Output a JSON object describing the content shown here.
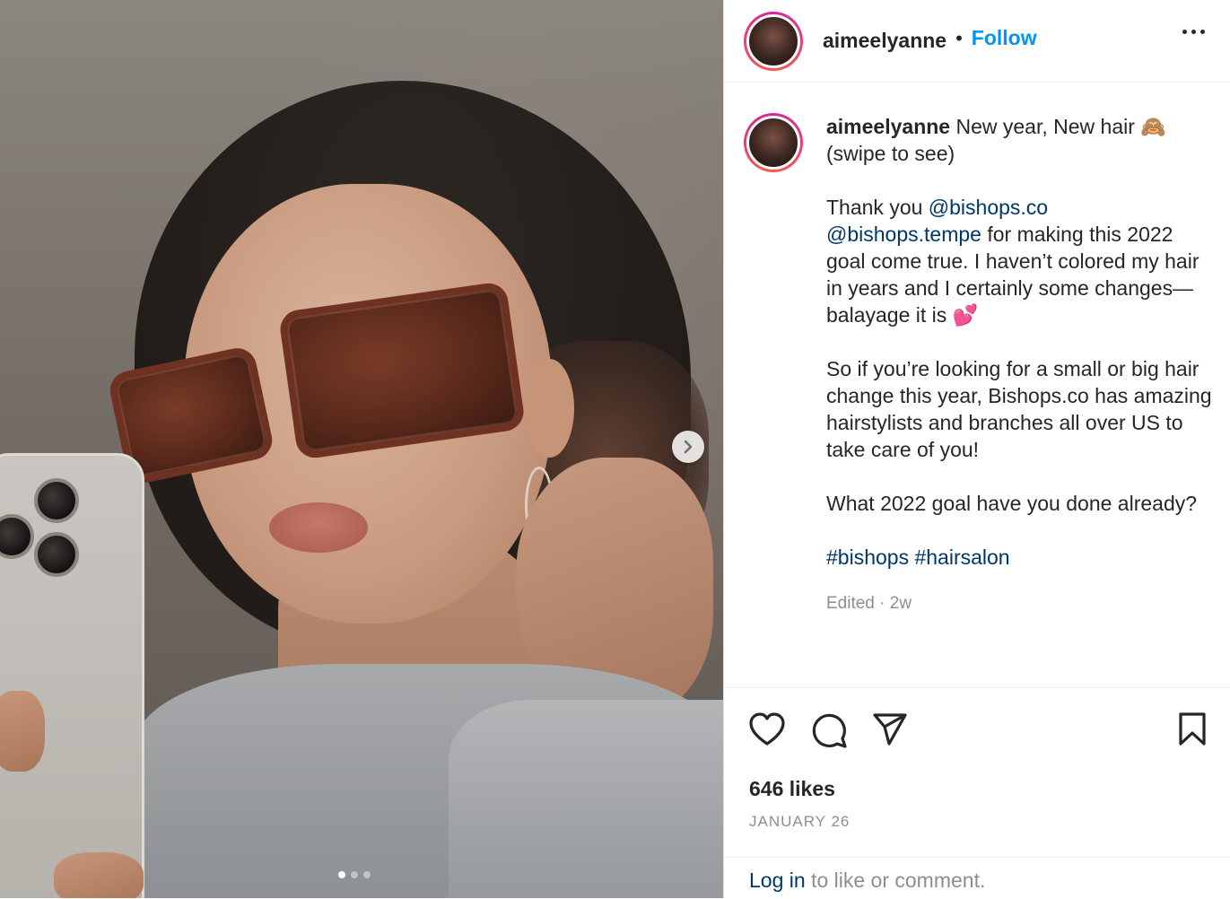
{
  "post": {
    "username": "aimeelyanne",
    "separator": "•",
    "follow_label": "Follow",
    "more_icon": "more-horizontal-icon"
  },
  "caption": {
    "username": "aimeelyanne",
    "line1": " New year, New hair 🙈",
    "line2": "(swipe to see)",
    "thanks_prefix": "Thank you ",
    "mention1": "@bishops.co",
    "mention2": "@bishops.tempe",
    "thanks_rest": " for making this 2022 goal come true. I haven’t colored my hair in years and I certainly some changes— balayage it is 💕",
    "paragraph2": "So if you’re looking for a small or big hair change this year, Bishops.co has amazing hairstylists and branches all over US to take care of you!",
    "paragraph3": "What 2022 goal have you done already?",
    "hashtag1": "#bishops",
    "hashtag2": "#hairsalon",
    "edited": "Edited · 2w"
  },
  "actions": {
    "like_icon": "heart-icon",
    "comment_icon": "comment-icon",
    "share_icon": "send-icon",
    "save_icon": "bookmark-icon"
  },
  "likes": "646 likes",
  "date": "JANUARY 26",
  "login": {
    "link": "Log in",
    "rest": " to like or comment."
  },
  "carousel": {
    "total": 3,
    "current": 1
  },
  "colors": {
    "accent": "#0095f6",
    "mention": "#00376b",
    "muted": "#8e8e8e"
  }
}
